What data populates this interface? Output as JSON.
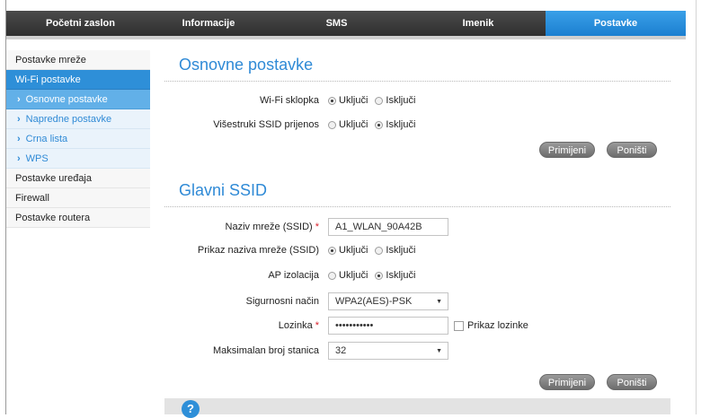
{
  "topnav": {
    "tabs": [
      "Početni zaslon",
      "Informacije",
      "SMS",
      "Imenik",
      "Postavke"
    ],
    "active": 4
  },
  "sidebar": {
    "items": [
      {
        "label": "Postavke mreže"
      },
      {
        "label": "Wi-Fi postavke"
      },
      {
        "label": "Osnovne postavke"
      },
      {
        "label": "Napredne postavke"
      },
      {
        "label": "Crna lista"
      },
      {
        "label": "WPS"
      },
      {
        "label": "Postavke uređaja"
      },
      {
        "label": "Firewall"
      },
      {
        "label": "Postavke routera"
      }
    ]
  },
  "basic": {
    "title": "Osnovne postavke",
    "wifi_switch": {
      "label": "Wi-Fi sklopka",
      "on": "Uključi",
      "off": "Isključi",
      "selected": "on"
    },
    "multi_ssid": {
      "label": "Višestruki SSID prijenos",
      "on": "Uključi",
      "off": "Isključi",
      "selected": "off"
    },
    "apply": "Primijeni",
    "cancel": "Poništi"
  },
  "ssid": {
    "title": "Glavni SSID",
    "name": {
      "label": "Naziv mreže (SSID)",
      "value": "A1_WLAN_90A42B"
    },
    "broadcast": {
      "label": "Prikaz naziva mreže (SSID)",
      "on": "Uključi",
      "off": "Isključi",
      "selected": "on"
    },
    "ap_isolation": {
      "label": "AP izolacija",
      "on": "Uključi",
      "off": "Isključi",
      "selected": "off"
    },
    "security": {
      "label": "Sigurnosni način",
      "value": "WPA2(AES)-PSK"
    },
    "password": {
      "label": "Lozinka",
      "value": "•••••••••••",
      "show_label": "Prikaz lozinke"
    },
    "max_stations": {
      "label": "Maksimalan broj stanica",
      "value": "32"
    },
    "apply": "Primijeni",
    "cancel": "Poništi"
  },
  "required_mark": "*",
  "help": {
    "icon": "?"
  }
}
